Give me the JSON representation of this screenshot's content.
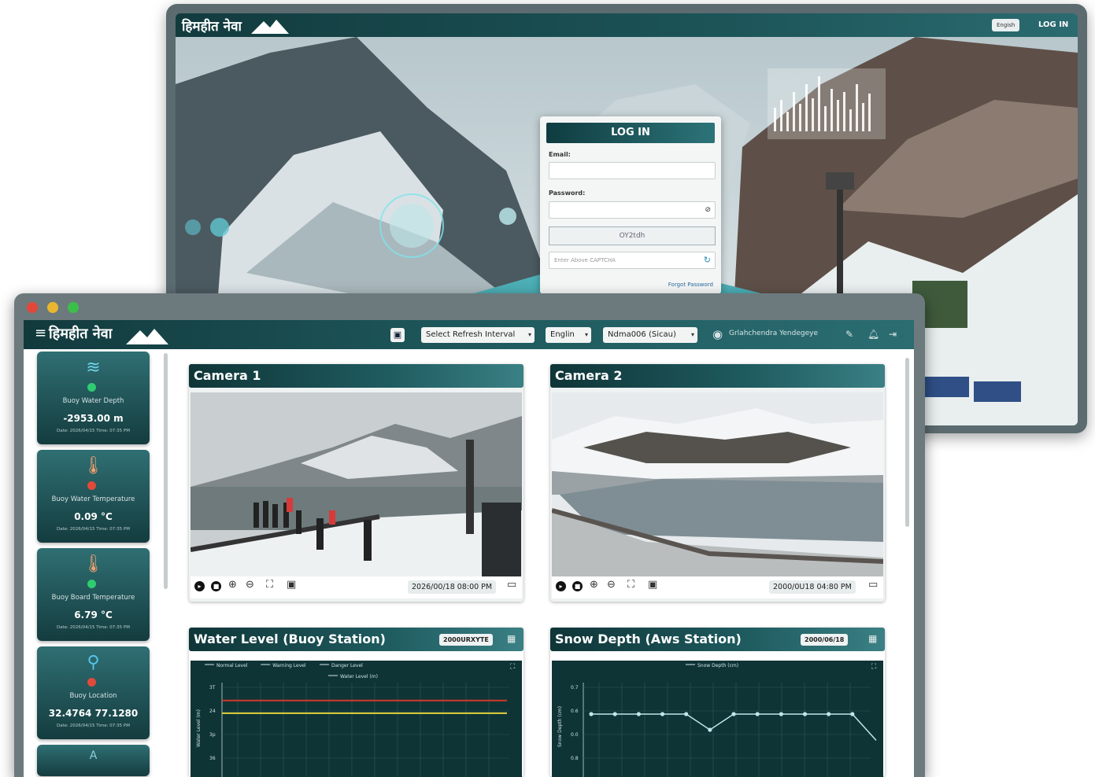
{
  "back_window": {
    "logo": "हिमहीत नेवा",
    "lang_select": "Engish",
    "login_link": "LOG IN",
    "login_form": {
      "title": "LOG IN",
      "email_label": "Email:",
      "password_label": "Password:",
      "captcha_value": "OY2tdh",
      "captcha_placeholder": "Enter Above CAPTCHA",
      "forgot": "Forgot Password"
    }
  },
  "front_window": {
    "logo": "हिमहीत नेवा",
    "refresh_select": "Select Refresh Interval",
    "lang_select": "Englin",
    "station_select": "Ndma006 (Sicau)",
    "user_name": "Grlahchendra Yendegeye",
    "sidebar": {
      "cards": [
        {
          "title": "Buoy Water Depth",
          "value": "-2953.00 m",
          "sub": "Date: 2026/04/15 Time: 07:35 PM",
          "status": "#2ecc71",
          "icon": "waves-icon"
        },
        {
          "title": "Buoy Water Temperature",
          "value": "0.09 °C",
          "sub": "Date: 2026/04/15 Time: 07:35 PM",
          "status": "#e04a3a",
          "icon": "thermometer-icon"
        },
        {
          "title": "Buoy Board Temperature",
          "value": "6.79 °C",
          "sub": "Date: 2026/04/15 Time: 07:35 PM",
          "status": "#2ecc71",
          "icon": "thermometer-icon"
        },
        {
          "title": "Buoy Location",
          "value": "32.4764 77.1280",
          "sub": "Date: 2026/04/15 Time: 07:35 PM",
          "status": "#e04a3a",
          "icon": "location-pin-icon"
        }
      ],
      "partial_label": "A"
    },
    "cameras": [
      {
        "title": "Camera 1",
        "timestamp": "2026/00/18 08:00 PM"
      },
      {
        "title": "Camera 2",
        "timestamp": "2000/0U18 04:80 PM"
      }
    ],
    "charts_panels": [
      {
        "title": "Water Level (Buoy Station)",
        "badge": "2000URXYTE"
      },
      {
        "title": "Snow Depth (Aws Station)",
        "badge": "2000/06/18"
      }
    ]
  },
  "chart_data": [
    {
      "type": "line",
      "title": "",
      "legend": [
        "Normal Level",
        "Warning Level",
        "Danger Level",
        "Water Level (m)"
      ],
      "ylabel": "Water Level (m)",
      "yticks": [
        "3T",
        "24",
        "3p",
        "36"
      ],
      "series": [
        {
          "name": "Danger Level",
          "values": [
            3,
            3
          ],
          "color": "#d03a2a"
        },
        {
          "name": "Warning Level",
          "values": [
            2.5,
            2.5
          ],
          "color": "#e3d33a"
        }
      ]
    },
    {
      "type": "line",
      "title": "",
      "legend": [
        "Snow Depth (cm)"
      ],
      "ylabel": "Snow Depth (cm)",
      "yticks": [
        "0.7",
        "0.6",
        "0.0",
        "0.8"
      ],
      "series": [
        {
          "name": "Snow Depth (cm)",
          "values": [
            0.6,
            0.6,
            0.6,
            0.6,
            0.6,
            0.45,
            0.6,
            0.6,
            0.6,
            0.6,
            0.6,
            0.6,
            0.35
          ],
          "color": "#bfe6e8"
        }
      ]
    }
  ]
}
